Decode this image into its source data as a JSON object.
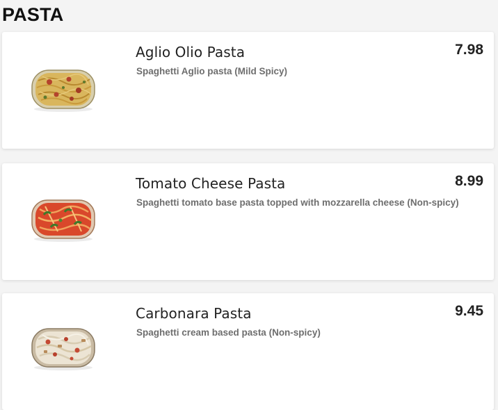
{
  "section": {
    "title": "PASTA"
  },
  "items": [
    {
      "name": "Aglio Olio Pasta",
      "description": "Spaghetti Aglio pasta (Mild Spicy)",
      "price": "7.98",
      "image_icon": "aglio-olio-pasta-image"
    },
    {
      "name": "Tomato Cheese Pasta",
      "description": "Spaghetti tomato base pasta topped with mozzarella cheese (Non-spicy)",
      "price": "8.99",
      "image_icon": "tomato-cheese-pasta-image"
    },
    {
      "name": "Carbonara Pasta",
      "description": "Spaghetti cream based pasta (Non-spicy)",
      "price": "9.45",
      "image_icon": "carbonara-pasta-image"
    }
  ],
  "colors": {
    "page_background": "#f4f4f4",
    "card_background": "#ffffff",
    "title_text": "#111111",
    "name_text": "#222222",
    "description_text": "#6e6e6e",
    "price_text": "#222222"
  }
}
